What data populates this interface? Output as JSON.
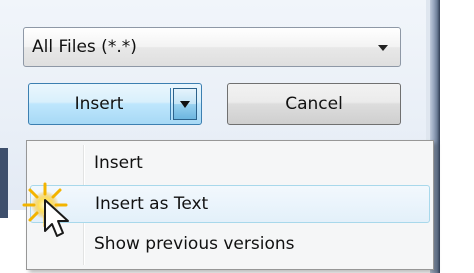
{
  "file_type": {
    "selected": "All Files (*.*)"
  },
  "buttons": {
    "insert_label": "Insert",
    "cancel_label": "Cancel"
  },
  "menu": {
    "items": [
      {
        "label": "Insert"
      },
      {
        "label": "Insert as Text"
      },
      {
        "label": "Show previous versions"
      }
    ],
    "hovered_label": "Insert as Text"
  },
  "icons": {
    "combo_arrow": "chevron-down-icon",
    "split_arrow": "chevron-down-icon",
    "pointer": "mouse-pointer-icon",
    "highlight": "click-highlight-icon"
  },
  "colors": {
    "accent_border": "#3c7fb1",
    "hover_border": "#a8d8eb",
    "menu_background": "#f5f6f7"
  }
}
